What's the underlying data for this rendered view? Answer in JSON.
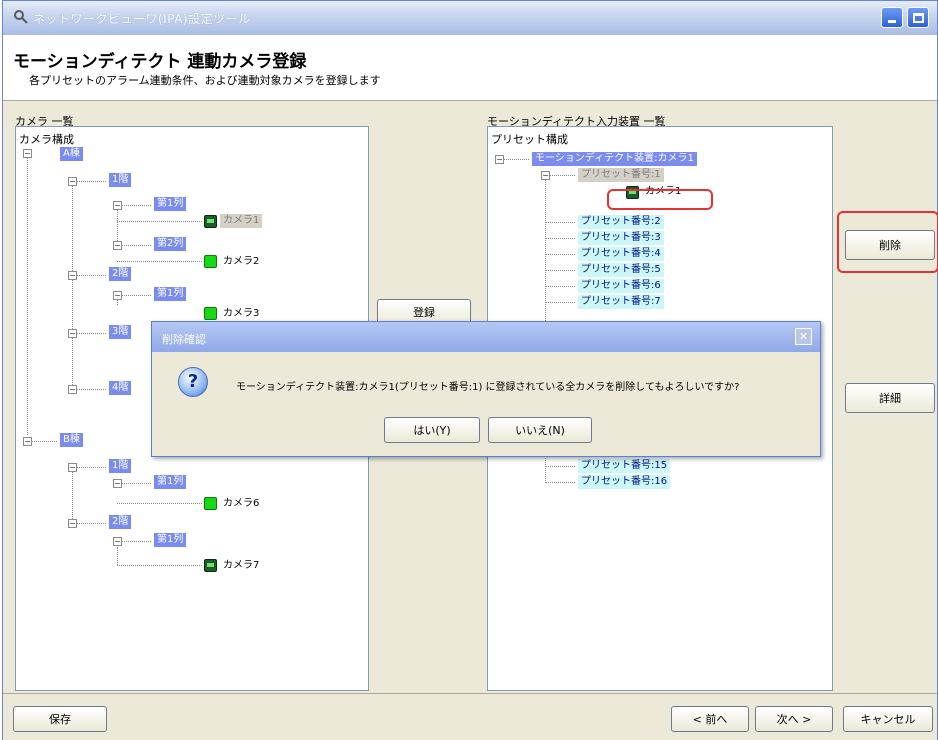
{
  "window": {
    "title": "ネットワークビューワ(IPA)設定ツール"
  },
  "header": {
    "title": "モーションディテクト 連動カメラ登録",
    "subtitle": "各プリセットのアラーム連動条件、および連動対象カメラを登録します"
  },
  "left_panel": {
    "label": "カメラ 一覧",
    "root": "カメラ構成",
    "nodes": {
      "bldg_a": "A棟",
      "floor1": "1階",
      "row1": "第1列",
      "cam1": "カメラ1",
      "row2": "第2列",
      "cam2": "カメラ2",
      "floor2": "2階",
      "row1b": "第1列",
      "cam3": "カメラ3",
      "floor3": "3階",
      "floor4": "4階",
      "bldg_b": "B棟",
      "b_floor1": "1階",
      "b_row1": "第1列",
      "cam6": "カメラ6",
      "b_floor2": "2階",
      "b_row1b": "第1列",
      "cam7": "カメラ7"
    }
  },
  "register_button": "登録",
  "right_panel": {
    "label": "モーションディテクト入力装置 一覧",
    "root": "プリセット構成",
    "device": "モーションディテクト装置:カメラ1",
    "presets": [
      "プリセット番号:1",
      "プリセット番号:2",
      "プリセット番号:3",
      "プリセット番号:4",
      "プリセット番号:5",
      "プリセット番号:6",
      "プリセット番号:7",
      "プリセット番号:15",
      "プリセット番号:16"
    ],
    "preset1_camera": "カメラ1"
  },
  "side_buttons": {
    "delete": "削除",
    "detail": "詳細"
  },
  "footer": {
    "save": "保存",
    "prev": "< 前へ",
    "next": "次へ >",
    "cancel": "キャンセル"
  },
  "dialog": {
    "title": "削除確認",
    "message": "モーションディテクト装置:カメラ1(プリセット番号:1) に登録されている全カメラを削除してもよろしいですか?",
    "yes": "はい(Y)",
    "no": "いいえ(N)"
  }
}
